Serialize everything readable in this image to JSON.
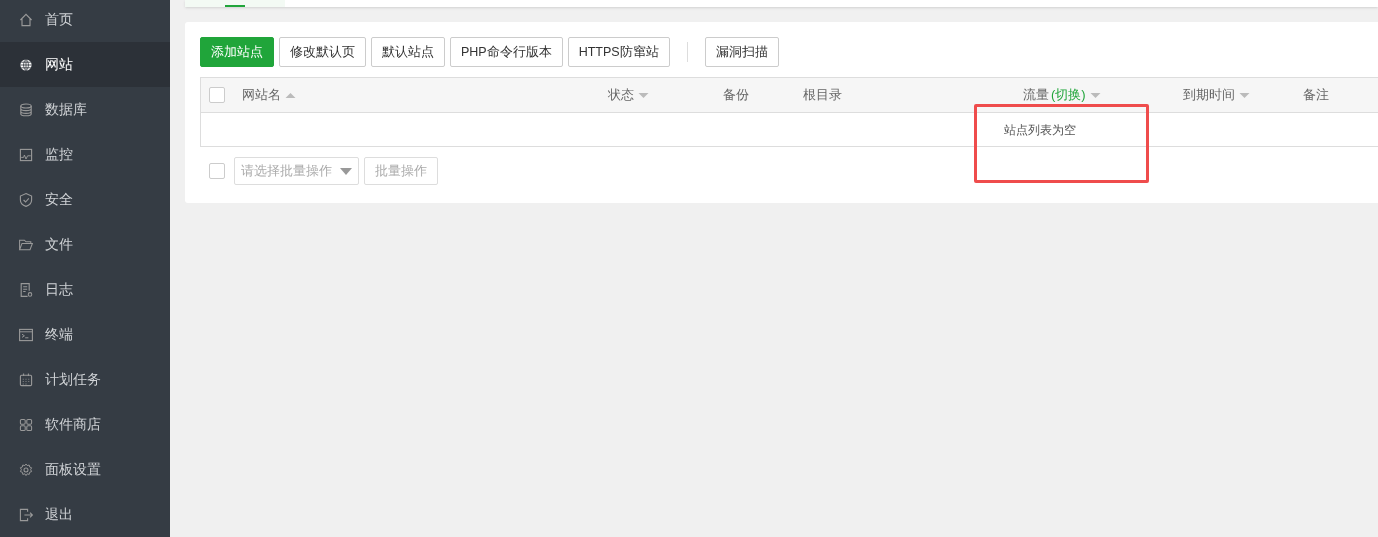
{
  "sidebar": {
    "items": [
      {
        "label": "首页",
        "selected": false
      },
      {
        "label": "网站",
        "selected": true
      },
      {
        "label": "数据库",
        "selected": false
      },
      {
        "label": "监控",
        "selected": false
      },
      {
        "label": "安全",
        "selected": false
      },
      {
        "label": "文件",
        "selected": false
      },
      {
        "label": "日志",
        "selected": false
      },
      {
        "label": "终端",
        "selected": false
      },
      {
        "label": "计划任务",
        "selected": false
      },
      {
        "label": "软件商店",
        "selected": false
      },
      {
        "label": "面板设置",
        "selected": false
      },
      {
        "label": "退出",
        "selected": false
      }
    ]
  },
  "toolbar": {
    "buttons": [
      {
        "label": "添加站点",
        "kind": "primary"
      },
      {
        "label": "修改默认页",
        "kind": "default"
      },
      {
        "label": "默认站点",
        "kind": "default"
      },
      {
        "label": "PHP命令行版本",
        "kind": "default"
      },
      {
        "label": "HTTPS防窜站",
        "kind": "default"
      },
      {
        "label": "漏洞扫描",
        "kind": "default"
      }
    ]
  },
  "table": {
    "select_all": {
      "checked": false
    },
    "columns": [
      {
        "label": "网站名",
        "sortable": true,
        "ascending": true
      },
      {
        "label": "状态",
        "sortable": true,
        "ascending": false
      },
      {
        "label": "备份",
        "sortable": false
      },
      {
        "label": "根目录",
        "sortable": false
      },
      {
        "label": "流量",
        "link": "(切换)",
        "sortable": true,
        "ascending": false
      },
      {
        "label": "到期时间",
        "sortable": true,
        "ascending": false
      },
      {
        "label": "备注",
        "sortable": false
      }
    ],
    "empty_message": "站点列表为空"
  },
  "footer": {
    "select_all": {
      "checked": false
    },
    "batch_select": {
      "placeholder": "请选择批量操作"
    },
    "batch_button": {
      "label": "批量操作",
      "disabled": true
    }
  }
}
